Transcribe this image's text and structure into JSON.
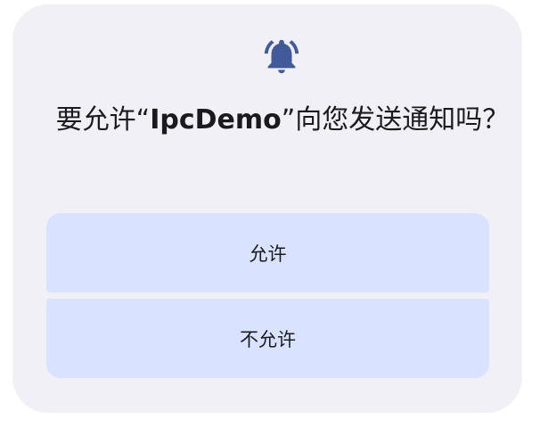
{
  "icon": "bell-ringing-icon",
  "colors": {
    "dialog_background": "#f1f0f7",
    "button_background": "#d9e2ff",
    "icon_color": "#425a9a",
    "text_color": "#1b1b1f"
  },
  "dialog": {
    "title_prefix": "要允许“",
    "app_name": "IpcDemo",
    "title_suffix": "”向您发送通知吗？"
  },
  "buttons": {
    "allow_label": "允许",
    "deny_label": "不允许"
  }
}
